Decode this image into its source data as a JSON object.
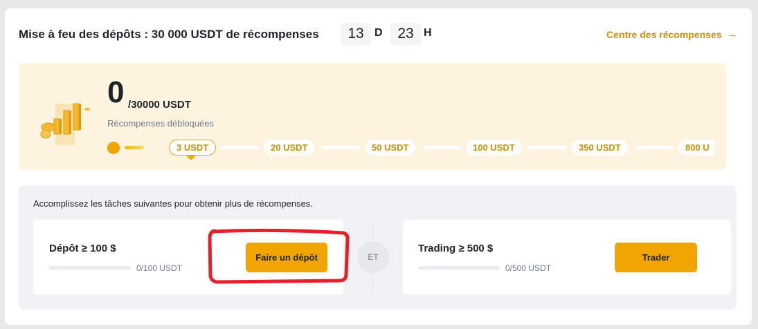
{
  "header": {
    "title": "Mise à feu des dépôts : 30 000 USDT de récompenses",
    "days": "13",
    "days_unit": "D",
    "hours": "23",
    "hours_unit": "H",
    "rewards_link": "Centre des récompenses",
    "rewards_link_icon": "arrow-right-icon"
  },
  "banner": {
    "unlocked_amount": "0",
    "total": "/30000 USDT",
    "unlocked_label": "Récompenses débloquées",
    "milestones": [
      "3 USDT",
      "20 USDT",
      "50 USDT",
      "100 USDT",
      "350 USDT",
      "800 U"
    ],
    "active_milestone_index": 0
  },
  "tasks": {
    "intro": "Accomplissez les tâches suivantes pour obtenir plus de récompenses.",
    "connector": "ET",
    "items": [
      {
        "label": "Dépôt ≥ 100 $",
        "progress": "0/100 USDT",
        "progress_fraction": 0,
        "button": "Faire un dépôt"
      },
      {
        "label": "Trading ≥ 500 $",
        "progress": "0/500 USDT",
        "progress_fraction": 0,
        "button": "Trader"
      }
    ]
  },
  "colors": {
    "accent": "#f0a500",
    "link": "#c99400",
    "banner_bg": "#fdf3df",
    "highlight_annotation": "#e8202a"
  }
}
